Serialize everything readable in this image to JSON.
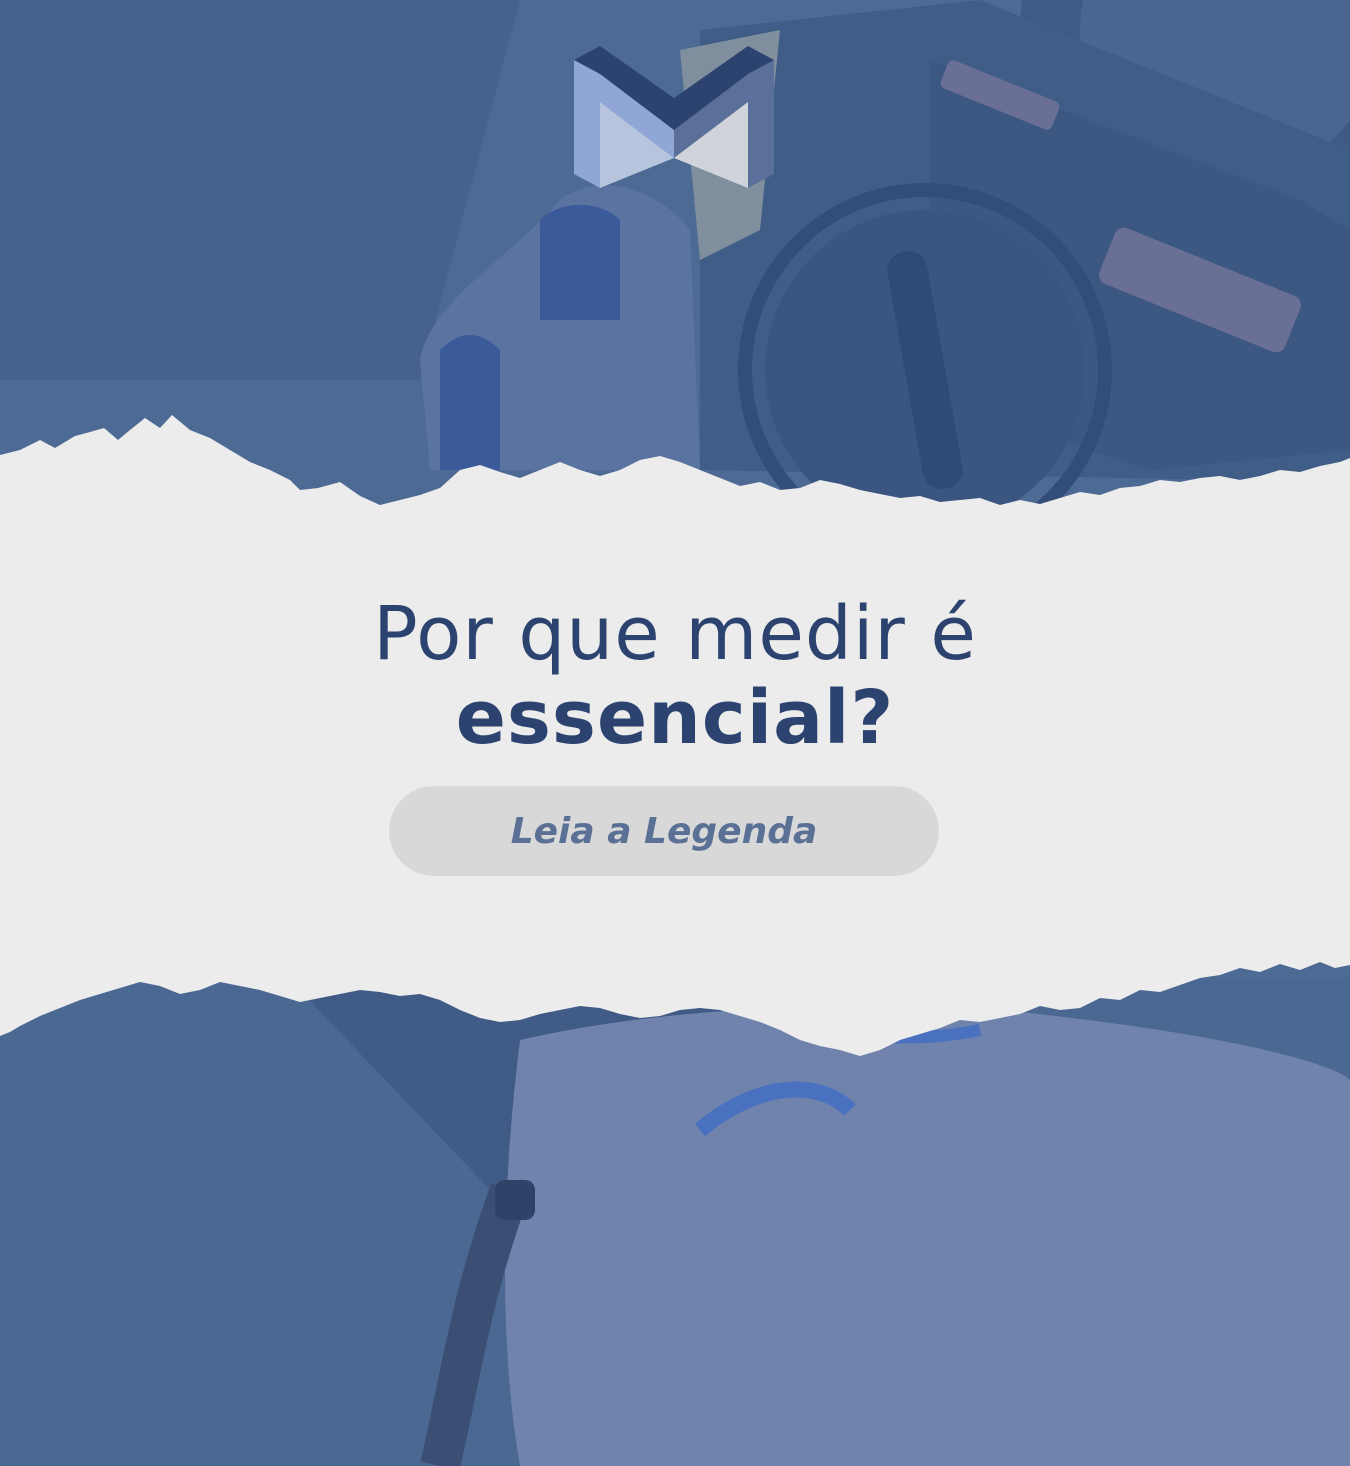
{
  "brand": {
    "logo_icon": "m-logo-icon",
    "colors": {
      "navy": "#2c4370",
      "blue_overlay": "#4d6a95",
      "light_blue": "#8fa6d6",
      "paper": "#ececec",
      "pill": "#d8d8d9",
      "pill_text": "#5a7195"
    }
  },
  "headline": {
    "line1": "Por que medir é",
    "line2_bold": "essencial",
    "line2_end": "?"
  },
  "caption_button": {
    "label": "Leia a Legenda"
  }
}
